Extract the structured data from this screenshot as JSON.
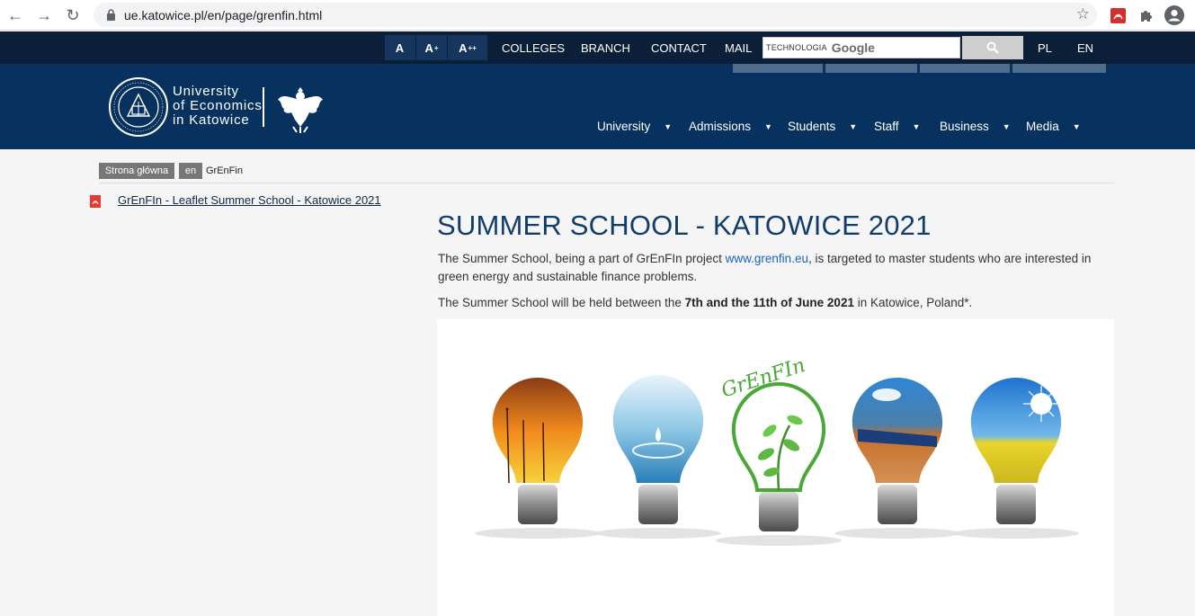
{
  "browser": {
    "url": "ue.katowice.pl/en/page/grenfin.html"
  },
  "topbar": {
    "font_sizes": [
      {
        "label": "A",
        "sup": ""
      },
      {
        "label": "A",
        "sup": "+"
      },
      {
        "label": "A",
        "sup": "++"
      }
    ],
    "links": [
      "COLLEGES",
      "BRANCH",
      "CONTACT",
      "MAIL"
    ],
    "search_prefix": "TECHNOLOGIA",
    "search_brand": "Google",
    "languages": [
      "PL",
      "EN"
    ]
  },
  "header": {
    "university_line1": "University",
    "university_line2": "of Economics",
    "university_line3": "in Katowice",
    "menu": [
      "University",
      "Admissions",
      "Students",
      "Staff",
      "Business",
      "Media"
    ]
  },
  "breadcrumb": {
    "home": "Strona główna",
    "lang": "en",
    "current": "GrEnFin"
  },
  "sidebar": {
    "leaflet_link": "GrEnFIn - Leaflet Summer School - Katowice 2021"
  },
  "content": {
    "title": "SUMMER SCHOOL - KATOWICE 2021",
    "p1_start": "The Summer School, being a part of GrEnFIn project ",
    "p1_link": "www.grenfin.eu",
    "p1_end": ", is targeted to master students who are interested in green energy and sustainable finance problems.",
    "p2_start": "The Summer School will be held between the ",
    "p2_bold": "7th and the 11th of June 2021",
    "p2_end": " in Katowice, Poland*.",
    "logo_text": "GrEnFIn"
  },
  "colors": {
    "topbar": "#0b1f38",
    "header": "#073260",
    "title": "#123d6a",
    "link": "#1565c0"
  }
}
